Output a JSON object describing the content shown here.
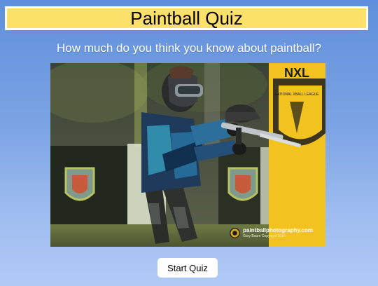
{
  "header": {
    "title": "Paintball Quiz"
  },
  "intro": {
    "question": "How much do you think you know about paintball?"
  },
  "hero_image": {
    "description": "Paintball player in blue camo jersey and goggles running with marker",
    "banner_text": "NXL",
    "banner_subtext": "NATIONAL XBALL LEAGUE",
    "watermark_site": "paintballphotography.com",
    "watermark_credit": "Gary Baum Copyright 2016"
  },
  "actions": {
    "start_label": "Start Quiz"
  },
  "colors": {
    "title_bg": "#fde06a",
    "background_top": "#5f8fdc",
    "background_bottom": "#b0caf6",
    "button_bg": "#ffffff"
  }
}
